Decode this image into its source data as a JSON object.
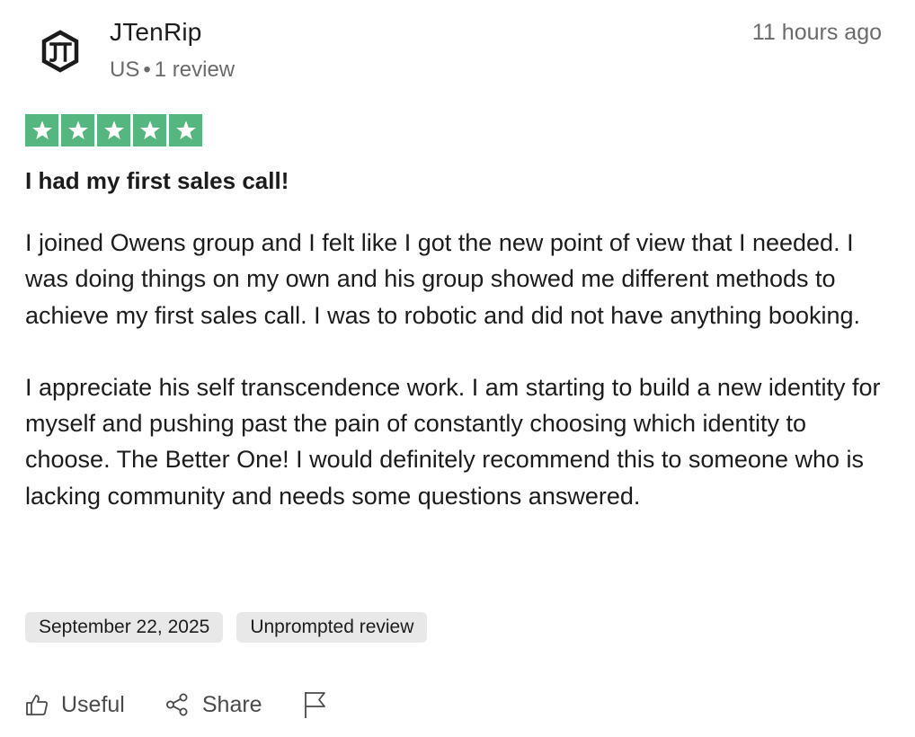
{
  "reviewer": {
    "name": "JTenRip",
    "country": "US",
    "separator": "•",
    "review_count": "1 review",
    "avatar_icon": "jt-logo-icon"
  },
  "timestamp": "11 hours ago",
  "rating": {
    "stars": 5,
    "max": 5,
    "color": "#55b77f"
  },
  "review": {
    "title": "I had my first sales call!",
    "paragraphs": [
      "I joined Owens group and I felt like I got the new point of view that I needed. I was doing things on my own and his group showed me different methods to achieve my first sales call. I was to robotic and did not have anything booking.",
      "I appreciate his self transcendence work. I am starting to build a new identity for myself and pushing past the pain of constantly choosing which identity to choose. The Better One! I would definitely recommend this to someone who is lacking community and needs some questions answered."
    ]
  },
  "tags": {
    "date": "September 22, 2025",
    "type": "Unprompted review"
  },
  "actions": {
    "useful_label": "Useful",
    "share_label": "Share",
    "useful_icon": "thumbs-up-icon",
    "share_icon": "share-icon",
    "flag_icon": "flag-icon"
  }
}
